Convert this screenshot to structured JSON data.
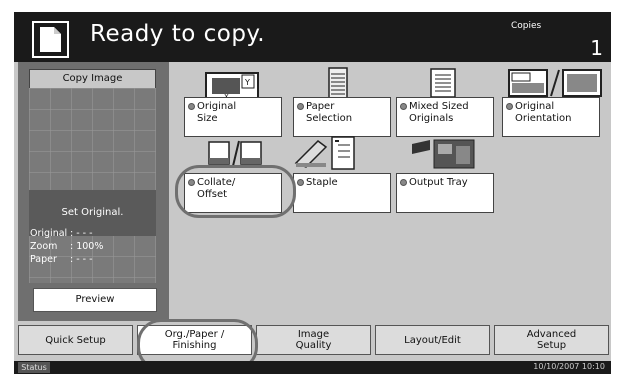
{
  "header": {
    "title": "Ready to copy.",
    "copies_label": "Copies",
    "copies_value": "1"
  },
  "left_panel": {
    "copy_image_label": "Copy Image",
    "set_original": "Set Original.",
    "original_key": "Original",
    "original_value": ": - - -",
    "zoom_key": "Zoom",
    "zoom_value": ": 100%",
    "paper_key": "Paper",
    "paper_value": ": - - -",
    "preview_label": "Preview"
  },
  "options": {
    "original_size": [
      "Original",
      "Size"
    ],
    "paper_selection": [
      "Paper",
      "Selection"
    ],
    "mixed_sized_originals": [
      "Mixed Sized",
      "Originals"
    ],
    "original_orientation": [
      "Original",
      "Orientation"
    ],
    "collate_offset": [
      "Collate/",
      "Offset"
    ],
    "staple": [
      "Staple"
    ],
    "output_tray": [
      "Output Tray"
    ]
  },
  "tabs": {
    "quick_setup": [
      "Quick Setup"
    ],
    "org_paper_finishing": [
      "Org./Paper /",
      "Finishing"
    ],
    "image_quality": [
      "Image",
      "Quality"
    ],
    "layout_edit": [
      "Layout/Edit"
    ],
    "advanced_setup": [
      "Advanced",
      "Setup"
    ],
    "active": "org_paper_finishing"
  },
  "status": {
    "label": "Status",
    "datetime": "10/10/2007  10:10"
  },
  "colors": {
    "header_bg": "#1a1a1a",
    "panel_bg": "#c8c8c8",
    "left_panel_bg": "#6f6f6f",
    "button_bg": "#ffffff"
  }
}
